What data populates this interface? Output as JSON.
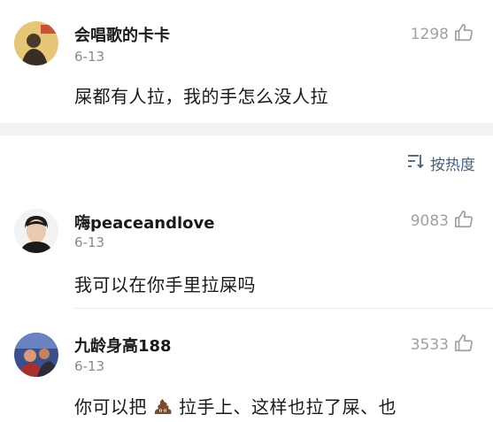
{
  "comments": [
    {
      "username": "会唱歌的卡卡",
      "date": "6-13",
      "likes": "1298",
      "text": "屎都有人拉，我的手怎么没人拉"
    },
    {
      "username": "嗨peaceandlove",
      "date": "6-13",
      "likes": "9083",
      "text": "我可以在你手里拉屎吗"
    },
    {
      "username": "九龄身高188",
      "date": "6-13",
      "likes": "3533",
      "text_before": "你可以把",
      "emoji": "poop-emoji",
      "text_after": "拉手上、这样也拉了屎、也"
    }
  ],
  "sort": {
    "label": "按热度"
  },
  "colors": {
    "sort_accent": "#48607a",
    "muted": "#a0a0a0",
    "divider": "#f2f2f2"
  }
}
